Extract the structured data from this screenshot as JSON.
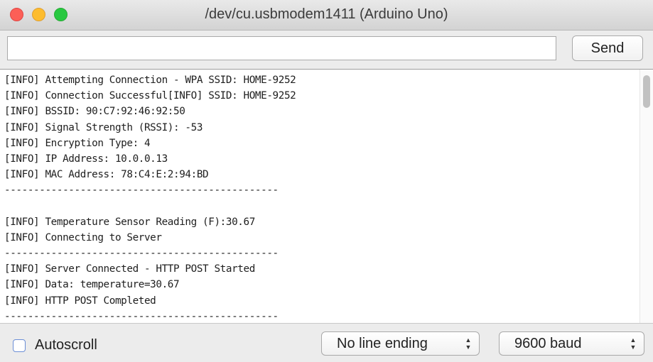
{
  "window": {
    "title": "/dev/cu.usbmodem1411 (Arduino Uno)"
  },
  "toolbar": {
    "input_value": "",
    "send_label": "Send"
  },
  "log": {
    "lines": [
      "[INFO] Attempting Connection - WPA SSID: HOME-9252",
      "[INFO] Connection Successful[INFO] SSID: HOME-9252",
      "[INFO] BSSID: 90:C7:92:46:92:50",
      "[INFO] Signal Strength (RSSI): -53",
      "[INFO] Encryption Type: 4",
      "[INFO] IP Address: 10.0.0.13",
      "[INFO] MAC Address: 78:C4:E:2:94:BD",
      "-----------------------------------------------",
      "",
      "[INFO] Temperature Sensor Reading (F):30.67",
      "[INFO] Connecting to Server",
      "-----------------------------------------------",
      "[INFO] Server Connected - HTTP POST Started",
      "[INFO] Data: temperature=30.67",
      "[INFO] HTTP POST Completed",
      "-----------------------------------------------"
    ]
  },
  "statusbar": {
    "autoscroll_label": "Autoscroll",
    "autoscroll_checked": false,
    "line_ending": "No line ending",
    "baud_rate": "9600 baud"
  },
  "colors": {
    "close": "#fc5f57",
    "minimize": "#fdbc2e",
    "maximize": "#28c840"
  }
}
